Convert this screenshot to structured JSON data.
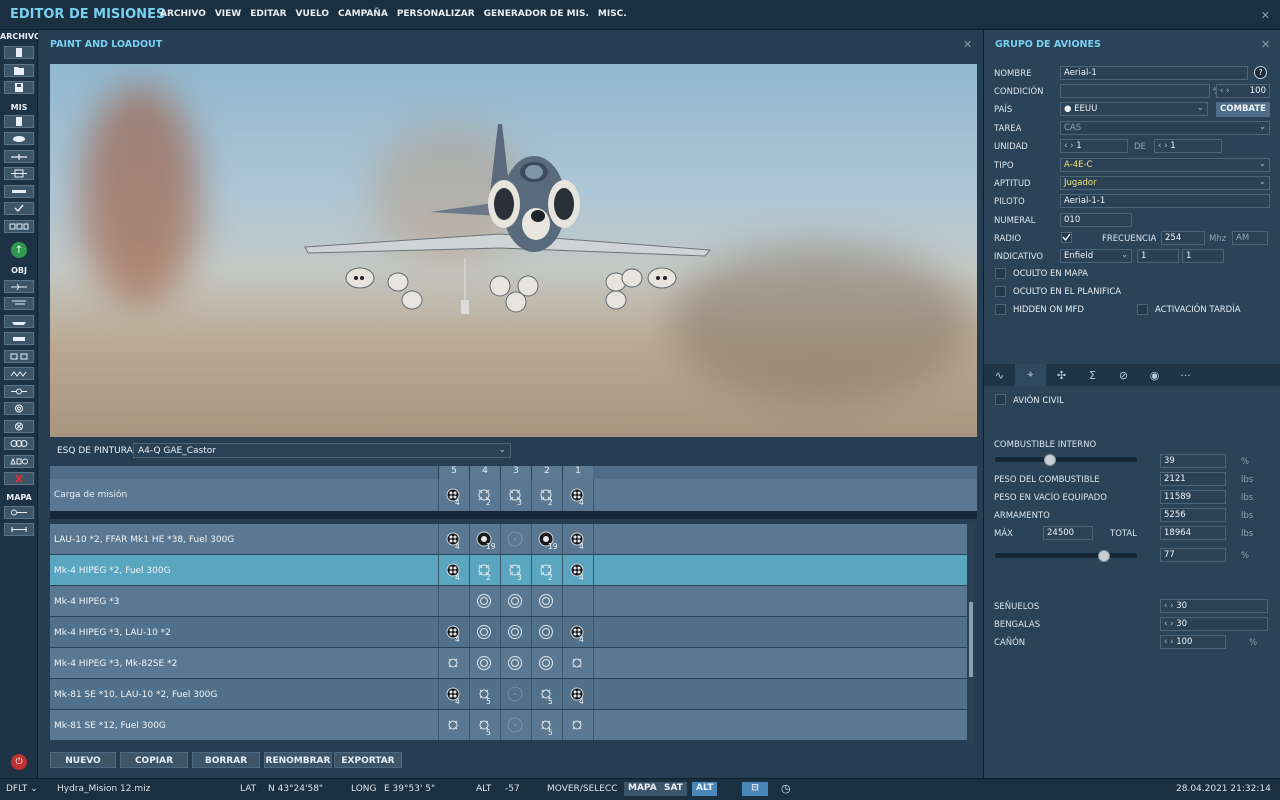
{
  "app": {
    "title": "EDITOR DE MISIONES"
  },
  "menu": [
    "ARCHIVO",
    "VIEW",
    "EDITAR",
    "VUELO",
    "CAMPAÑA",
    "PERSONALIZAR",
    "GENERADOR DE MIS.",
    "MISC."
  ],
  "toolbar": {
    "sections": {
      "archivo": "ARCHIVO",
      "mis": "MIS",
      "obj": "OBJ",
      "mapa": "MAPA"
    }
  },
  "paint_panel": {
    "title": "PAINT AND LOADOUT",
    "skin_label": "ESQ DE PINTURA",
    "skin_value": "A4-Q GAE_Castor",
    "columns": [
      "5",
      "4",
      "3",
      "2",
      "1"
    ],
    "header_row": {
      "label": "Carga de misión",
      "counts": [
        "4",
        "2",
        "3",
        "2",
        "4"
      ]
    },
    "rows": [
      {
        "label": "LAU-10 *2, FFAR Mk1 HE *38, Fuel 300G",
        "counts": [
          "4",
          "19",
          "",
          "19",
          "4"
        ]
      },
      {
        "label": "Mk-4 HIPEG *2, Fuel 300G",
        "counts": [
          "4",
          "2",
          "3",
          "2",
          "4"
        ],
        "selected": true
      },
      {
        "label": "Mk-4 HIPEG *3",
        "counts": [
          "",
          "",
          "",
          "",
          ""
        ]
      },
      {
        "label": "Mk-4 HIPEG *3, LAU-10 *2",
        "counts": [
          "4",
          "",
          "",
          "",
          "4"
        ]
      },
      {
        "label": "Mk-4 HIPEG *3, Mk-82SE *2",
        "counts": [
          "",
          "",
          "",
          "",
          ""
        ]
      },
      {
        "label": "Mk-81 SE *10, LAU-10 *2, Fuel 300G",
        "counts": [
          "4",
          "5",
          "",
          "5",
          "4"
        ]
      },
      {
        "label": "Mk-81 SE *12, Fuel 300G",
        "counts": [
          "",
          "5",
          "",
          "5",
          ""
        ]
      }
    ],
    "buttons": {
      "new": "NUEVO",
      "copy": "COPIAR",
      "delete": "BORRAR",
      "rename": "RENOMBRAR",
      "export": "EXPORTAR"
    }
  },
  "group_panel": {
    "title": "GRUPO DE AVIONES",
    "fields": {
      "name_label": "NOMBRE",
      "name_value": "Aerial-1",
      "condition_label": "CONDICIÓN",
      "condition_unit": "%",
      "condition_value": "100",
      "country_label": "PAÍS",
      "country_value": "EEUU",
      "combat_button": "COMBATE",
      "task_label": "TAREA",
      "task_value": "CAS",
      "unit_label": "UNIDAD",
      "unit_value": "1",
      "of_label": "DE",
      "of_value": "1",
      "type_label": "TIPO",
      "type_value": "A-4E-C",
      "skill_label": "APTITUD",
      "skill_value": "Jugador",
      "pilot_label": "PILOTO",
      "pilot_value": "Aerial-1-1",
      "numeral_label": "NUMERAL",
      "numeral_value": "010",
      "radio_label": "RADIO",
      "freq_label": "FRECUENCIA",
      "freq_value": "254",
      "freq_unit": "Mhz",
      "modulation": "AM",
      "callsign_label": "INDICATIVO",
      "callsign_value": "Enfield",
      "callsign_n1": "1",
      "callsign_n2": "1"
    },
    "checks": {
      "hidden_map": "OCULTO EN MAPA",
      "hidden_planner": "OCULTO EN EL PLANIFICA",
      "hidden_mfd": "HIDDEN ON MFD",
      "late_activation": "ACTIVACIÓN TARDÍA",
      "civil": "AVIÓN CIVIL"
    },
    "tab_icons": [
      "route-icon",
      "payload-icon",
      "drone-icon",
      "sigma-icon",
      "forbidden-icon",
      "radio-icon",
      "more-icon"
    ],
    "fuel": {
      "internal_label": "COMBUSTIBLE INTERNO",
      "internal_value": "39",
      "internal_percent": 39,
      "percent_unit": "%",
      "fuel_weight_label": "PESO DEL COMBUSTIBLE",
      "fuel_weight_value": "2121",
      "empty_weight_label": "PESO EN VACÍO EQUIPADO",
      "empty_weight_value": "11589",
      "armament_label": "ARMAMENTO",
      "armament_value": "5256",
      "max_label": "MÁX",
      "max_value": "24500",
      "total_label": "TOTAL",
      "total_value": "18964",
      "unit": "lbs",
      "load_value": "77",
      "load_percent": 77
    },
    "countermeasures": {
      "chaff_label": "SEÑUELOS",
      "chaff_value": "30",
      "flare_label": "BENGALAS",
      "flare_value": "30",
      "gun_label": "CAÑÓN",
      "gun_value": "100",
      "gun_unit": "%"
    }
  },
  "status": {
    "mode": "DFLT",
    "file": "Hydra_Mision 12.miz",
    "lat_label": "LAT",
    "lat_value": "N 43°24'58\"",
    "long_label": "LONG",
    "long_value": "E 39°53' 5\"",
    "alt_label": "ALT",
    "alt_value": "-57",
    "move_label": "MOVER/SELECC",
    "map_button": "MAPA",
    "sat_button": "SAT",
    "alt_button": "ALT",
    "datetime": "28.04.2021 21:32:14"
  },
  "colors": {
    "accent": "#7ad0f0",
    "panel": "#253e53",
    "selected_row": "#5aa6c0",
    "type_text": "#f0e070"
  }
}
